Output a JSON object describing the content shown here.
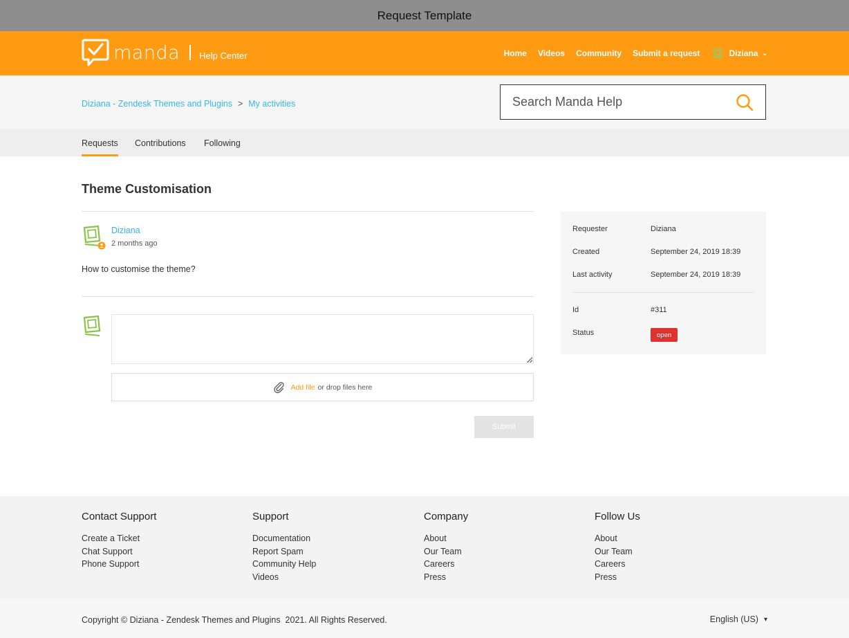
{
  "window": {
    "title": "Request Template"
  },
  "header": {
    "brand": "manda",
    "sub": "Help Center",
    "nav": [
      "Home",
      "Videos",
      "Community",
      "Submit a request"
    ],
    "user": "Diziana",
    "accent": "#fe9b13"
  },
  "breadcrumb": {
    "first": "Diziana - Zendesk Themes and Plugins",
    "separator": ">",
    "second": "My activities"
  },
  "search": {
    "placeholder": "Search Manda Help",
    "icon": "search-icon"
  },
  "tabs": [
    {
      "label": "Requests",
      "active": true
    },
    {
      "label": "Contributions",
      "active": false
    },
    {
      "label": "Following",
      "active": false
    }
  ],
  "request": {
    "title": "Theme Customisation",
    "author": "Diziana",
    "time": "2 months ago",
    "body": "How to customise the theme?"
  },
  "reply": {
    "upload_link": "Add file",
    "upload_text": "or drop files here",
    "submit": "Submit"
  },
  "details": {
    "requester_label": "Requester",
    "requester": "Diziana",
    "created_label": "Created",
    "created": "September 24, 2019 18:39",
    "last_activity_label": "Last activity",
    "last_activity": "September 24, 2019 18:39",
    "id_label": "Id",
    "id": "#311",
    "status_label": "Status",
    "status": "open",
    "status_color": "#e03131"
  },
  "footer": {
    "columns": [
      {
        "title": "Contact Support",
        "links": [
          "Create a Ticket",
          "Chat Support",
          "Phone Support"
        ]
      },
      {
        "title": "Support",
        "links": [
          "Documentation",
          "Report Spam",
          "Community Help",
          "Videos"
        ]
      },
      {
        "title": "Company",
        "links": [
          "About",
          "Our Team",
          "Careers",
          "Press"
        ]
      },
      {
        "title": "Follow Us",
        "links": [
          "About",
          "Our Team",
          "Careers",
          "Press"
        ]
      }
    ],
    "copyright": "Copyright © Diziana - Zendesk Themes and Plugins  2021. All Rights Reserved.",
    "language": "English (US)"
  }
}
